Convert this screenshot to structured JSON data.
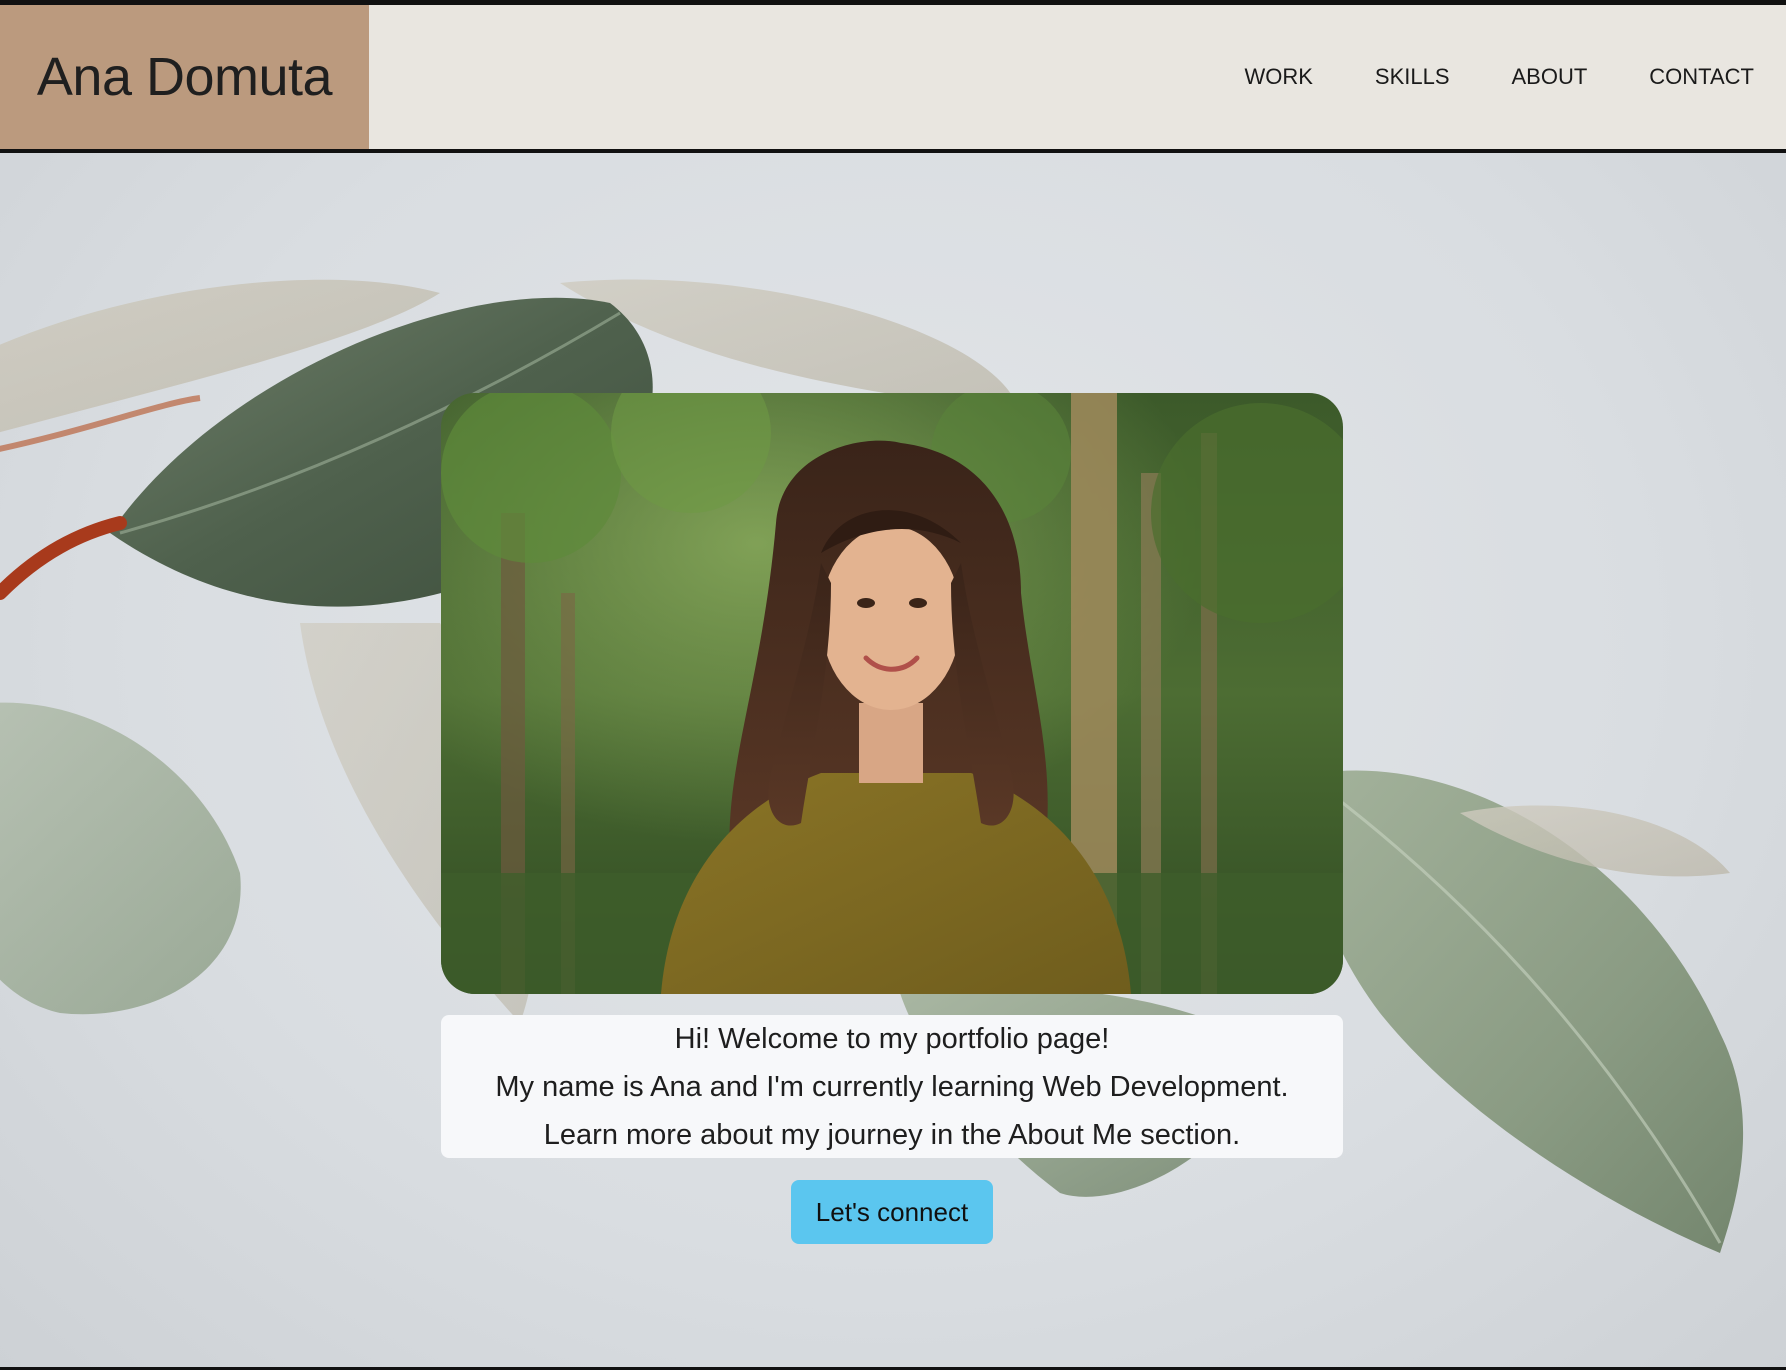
{
  "header": {
    "brand_name": "Ana Domuta",
    "nav": [
      {
        "label": "WORK"
      },
      {
        "label": "SKILLS"
      },
      {
        "label": "ABOUT"
      },
      {
        "label": "CONTACT"
      }
    ]
  },
  "hero": {
    "intro_lines": [
      "Hi! Welcome to my portfolio page!",
      "My name is Ana and I'm currently learning Web Development.",
      "Learn more about my journey in the About Me section."
    ],
    "cta_label": "Let's connect"
  },
  "colors": {
    "brand_bg": "#bb9a7e",
    "header_bg": "#e9e6e0",
    "cta_bg": "#5bc6ef",
    "intro_bg": "#f7f8fa"
  },
  "icons": [
    "leaf-decoration",
    "profile-photo"
  ]
}
